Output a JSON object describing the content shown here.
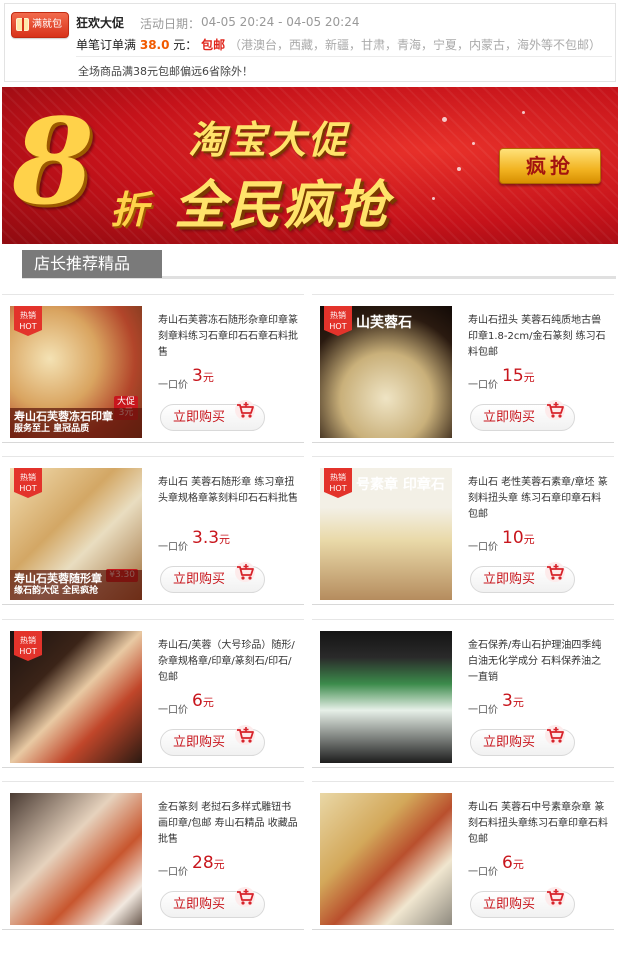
{
  "promo": {
    "badge": "满就包邮",
    "title": "狂欢大促",
    "date_label": "活动日期：",
    "date": "04-05 20:24 - 04-05 20:24",
    "line2_prefix": "单笔订单满",
    "line2_amount": "38.0",
    "line2_unit": "元：",
    "line2_free": "包邮",
    "line2_excluded": "（港澳台，西藏，新疆，甘肃，青海，宁夏，内蒙古，海外等不包邮）",
    "line3": "全场商品满38元包邮偏远6省除外！"
  },
  "banner": {
    "eight": "8",
    "zhe": "折",
    "line1": "淘宝大促",
    "line2": "全民疯抢",
    "cta": "疯抢"
  },
  "section": {
    "title": "店长推荐精品"
  },
  "products": [
    {
      "title": "寿山石芙蓉冻石随形杂章印章篆刻章料练习石章印石石章石料批售",
      "price_label": "一口价",
      "price": "3",
      "unit": "元",
      "buy": "立即购买",
      "hot_cn": "热销",
      "hot_en": "HOT",
      "caption": "寿山石芙蓉冻石印章",
      "caption2": "服务至上 皇冠品质",
      "tag1": "大促",
      "tag2": "3元",
      "top_text": ""
    },
    {
      "title": "寿山石扭头 芙蓉石纯质地古兽印章1.8-2cm/金石篆刻 练习石料包邮",
      "price_label": "一口价",
      "price": "15",
      "unit": "元",
      "buy": "立即购买",
      "hot_cn": "热销",
      "hot_en": "HOT",
      "caption": "",
      "caption2": "",
      "tag1": "",
      "tag2": "",
      "top_text": "山芙蓉石"
    },
    {
      "title": "寿山石 芙蓉石随形章 练习章扭头章规格章篆刻料印石石料批售",
      "price_label": "一口价",
      "price": "3.3",
      "unit": "元",
      "buy": "立即购买",
      "hot_cn": "热销",
      "hot_en": "HOT",
      "caption": "寿山石芙蓉随形章",
      "caption2": "缘石韵大促 全民疯抢",
      "tag1": "¥3.30",
      "tag2": "",
      "top_text": ""
    },
    {
      "title": "寿山石 老性芙蓉石素章/章坯 篆刻料扭头章 练习石章印章石料包邮",
      "price_label": "一口价",
      "price": "10",
      "unit": "元",
      "buy": "立即购买",
      "hot_cn": "热销",
      "hot_en": "HOT",
      "caption": "",
      "caption2": "",
      "tag1": "",
      "tag2": "",
      "top_text": "号素章 印章石"
    },
    {
      "title": "寿山石/芙蓉（大号珍品）随形/杂章规格章/印章/篆刻石/印石/包邮",
      "price_label": "一口价",
      "price": "6",
      "unit": "元",
      "buy": "立即购买",
      "hot_cn": "热销",
      "hot_en": "HOT",
      "caption": "",
      "caption2": "",
      "tag1": "",
      "tag2": "",
      "top_text": ""
    },
    {
      "title": "金石保养/寿山石护理油四季纯白油无化学成分 石料保养油之一直销",
      "price_label": "一口价",
      "price": "3",
      "unit": "元",
      "buy": "立即购买",
      "hot_cn": "",
      "hot_en": "",
      "caption": "",
      "caption2": "",
      "tag1": "",
      "tag2": "",
      "top_text": ""
    },
    {
      "title": "金石篆刻 老挝石多样式雕钮书画印章/包邮 寿山石精品 收藏品批售",
      "price_label": "一口价",
      "price": "28",
      "unit": "元",
      "buy": "立即购买",
      "hot_cn": "",
      "hot_en": "",
      "caption": "",
      "caption2": "",
      "tag1": "",
      "tag2": "",
      "top_text": ""
    },
    {
      "title": "寿山石 芙蓉石中号素章杂章 篆刻石料扭头章练习石章印章石料包邮",
      "price_label": "一口价",
      "price": "6",
      "unit": "元",
      "buy": "立即购买",
      "hot_cn": "",
      "hot_en": "",
      "caption": "",
      "caption2": "",
      "tag1": "",
      "tag2": "",
      "top_text": ""
    }
  ]
}
